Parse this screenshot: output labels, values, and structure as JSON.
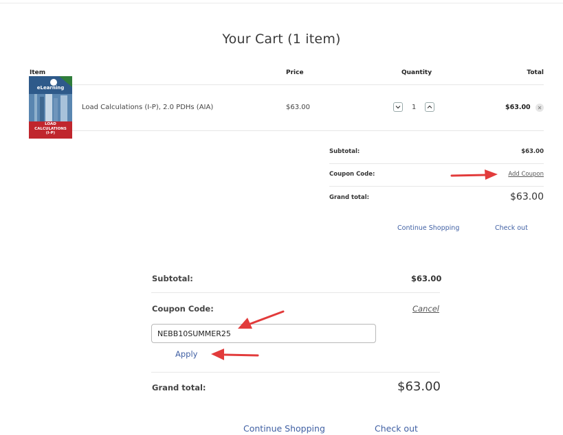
{
  "cart": {
    "title": "Your Cart (1 item)",
    "columns": {
      "item": "Item",
      "price": "Price",
      "quantity": "Quantity",
      "total": "Total"
    },
    "line_item": {
      "name": "Load Calculations (I-P), 2.0 PDHs (AIA)",
      "price": "$63.00",
      "quantity": "1",
      "total": "$63.00",
      "image_text": {
        "brand": "eLearning",
        "title_line1": "LOAD",
        "title_line2": "CALCULATIONS",
        "title_line3": "(I-P)"
      }
    },
    "summary": {
      "subtotal_label": "Subtotal:",
      "subtotal_value": "$63.00",
      "coupon_label": "Coupon Code:",
      "add_coupon": "Add Coupon",
      "grand_total_label": "Grand total:",
      "grand_total_value": "$63.00",
      "continue_shopping": "Continue Shopping",
      "check_out": "Check out"
    }
  },
  "coupon_panel": {
    "subtotal_label": "Subtotal:",
    "subtotal_value": "$63.00",
    "coupon_label": "Coupon Code:",
    "cancel": "Cancel",
    "coupon_value": "NEBB10SUMMER25",
    "apply": "Apply",
    "grand_total_label": "Grand total:",
    "grand_total_value": "$63.00",
    "continue_shopping": "Continue Shopping",
    "check_out": "Check out"
  },
  "colors": {
    "link": "#3f5fa3",
    "arrow": "#e23b3b",
    "book_green": "#2f7d3b",
    "book_red": "#c0262d"
  }
}
